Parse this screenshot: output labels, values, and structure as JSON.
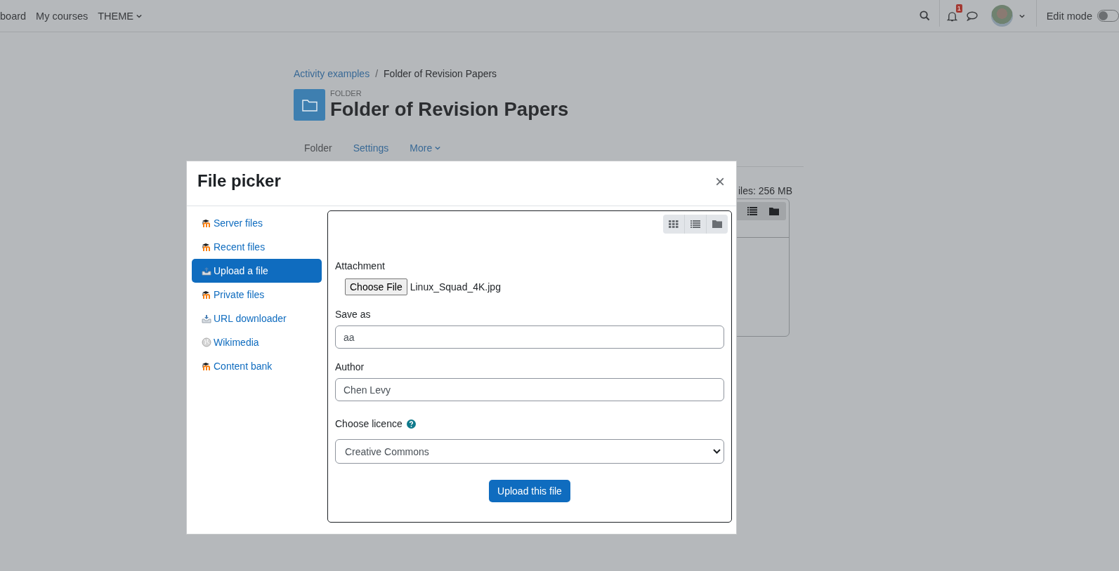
{
  "navbar": {
    "links": [
      "board",
      "My courses"
    ],
    "theme_menu": {
      "label": "THEME"
    },
    "notifications": {
      "count": "1"
    },
    "edit_mode": {
      "label": "Edit mode",
      "on": false
    }
  },
  "breadcrumb": [
    {
      "label": "Activity examples",
      "kind": "link"
    },
    {
      "label": "/",
      "kind": "separator"
    },
    {
      "label": "Folder of Revision Papers",
      "kind": "current"
    }
  ],
  "header": {
    "overline": "FOLDER",
    "title": "Folder of Revision Papers"
  },
  "tabs": [
    {
      "label": "Folder",
      "selected": true,
      "dropdown": false
    },
    {
      "label": "Settings",
      "selected": false,
      "dropdown": false
    },
    {
      "label": "More",
      "selected": false,
      "dropdown": true
    }
  ],
  "background": {
    "files_limit": "iles: 256 MB"
  },
  "file_picker": {
    "title": "File picker",
    "close": "×",
    "sources": [
      {
        "label": "Server files",
        "kind": "moodle",
        "selected": false
      },
      {
        "label": "Recent files",
        "kind": "moodle",
        "selected": false
      },
      {
        "label": "Upload a file",
        "kind": "upload",
        "selected": true
      },
      {
        "label": "Private files",
        "kind": "moodle",
        "selected": false
      },
      {
        "label": "URL downloader",
        "kind": "url",
        "selected": false
      },
      {
        "label": "Wikimedia",
        "kind": "wikimedia",
        "selected": false
      },
      {
        "label": "Content bank",
        "kind": "moodle",
        "selected": false
      }
    ],
    "form": {
      "attachment_label": "Attachment",
      "choose_button": "Choose File",
      "file_name": "Linux_Squad_4K.jpg",
      "save_as_label": "Save as",
      "save_as_value": "aa",
      "author_label": "Author",
      "author_value": "Chen Levy",
      "licence_label": "Choose licence",
      "licence_value": "Creative Commons",
      "upload_button": "Upload this file"
    }
  }
}
